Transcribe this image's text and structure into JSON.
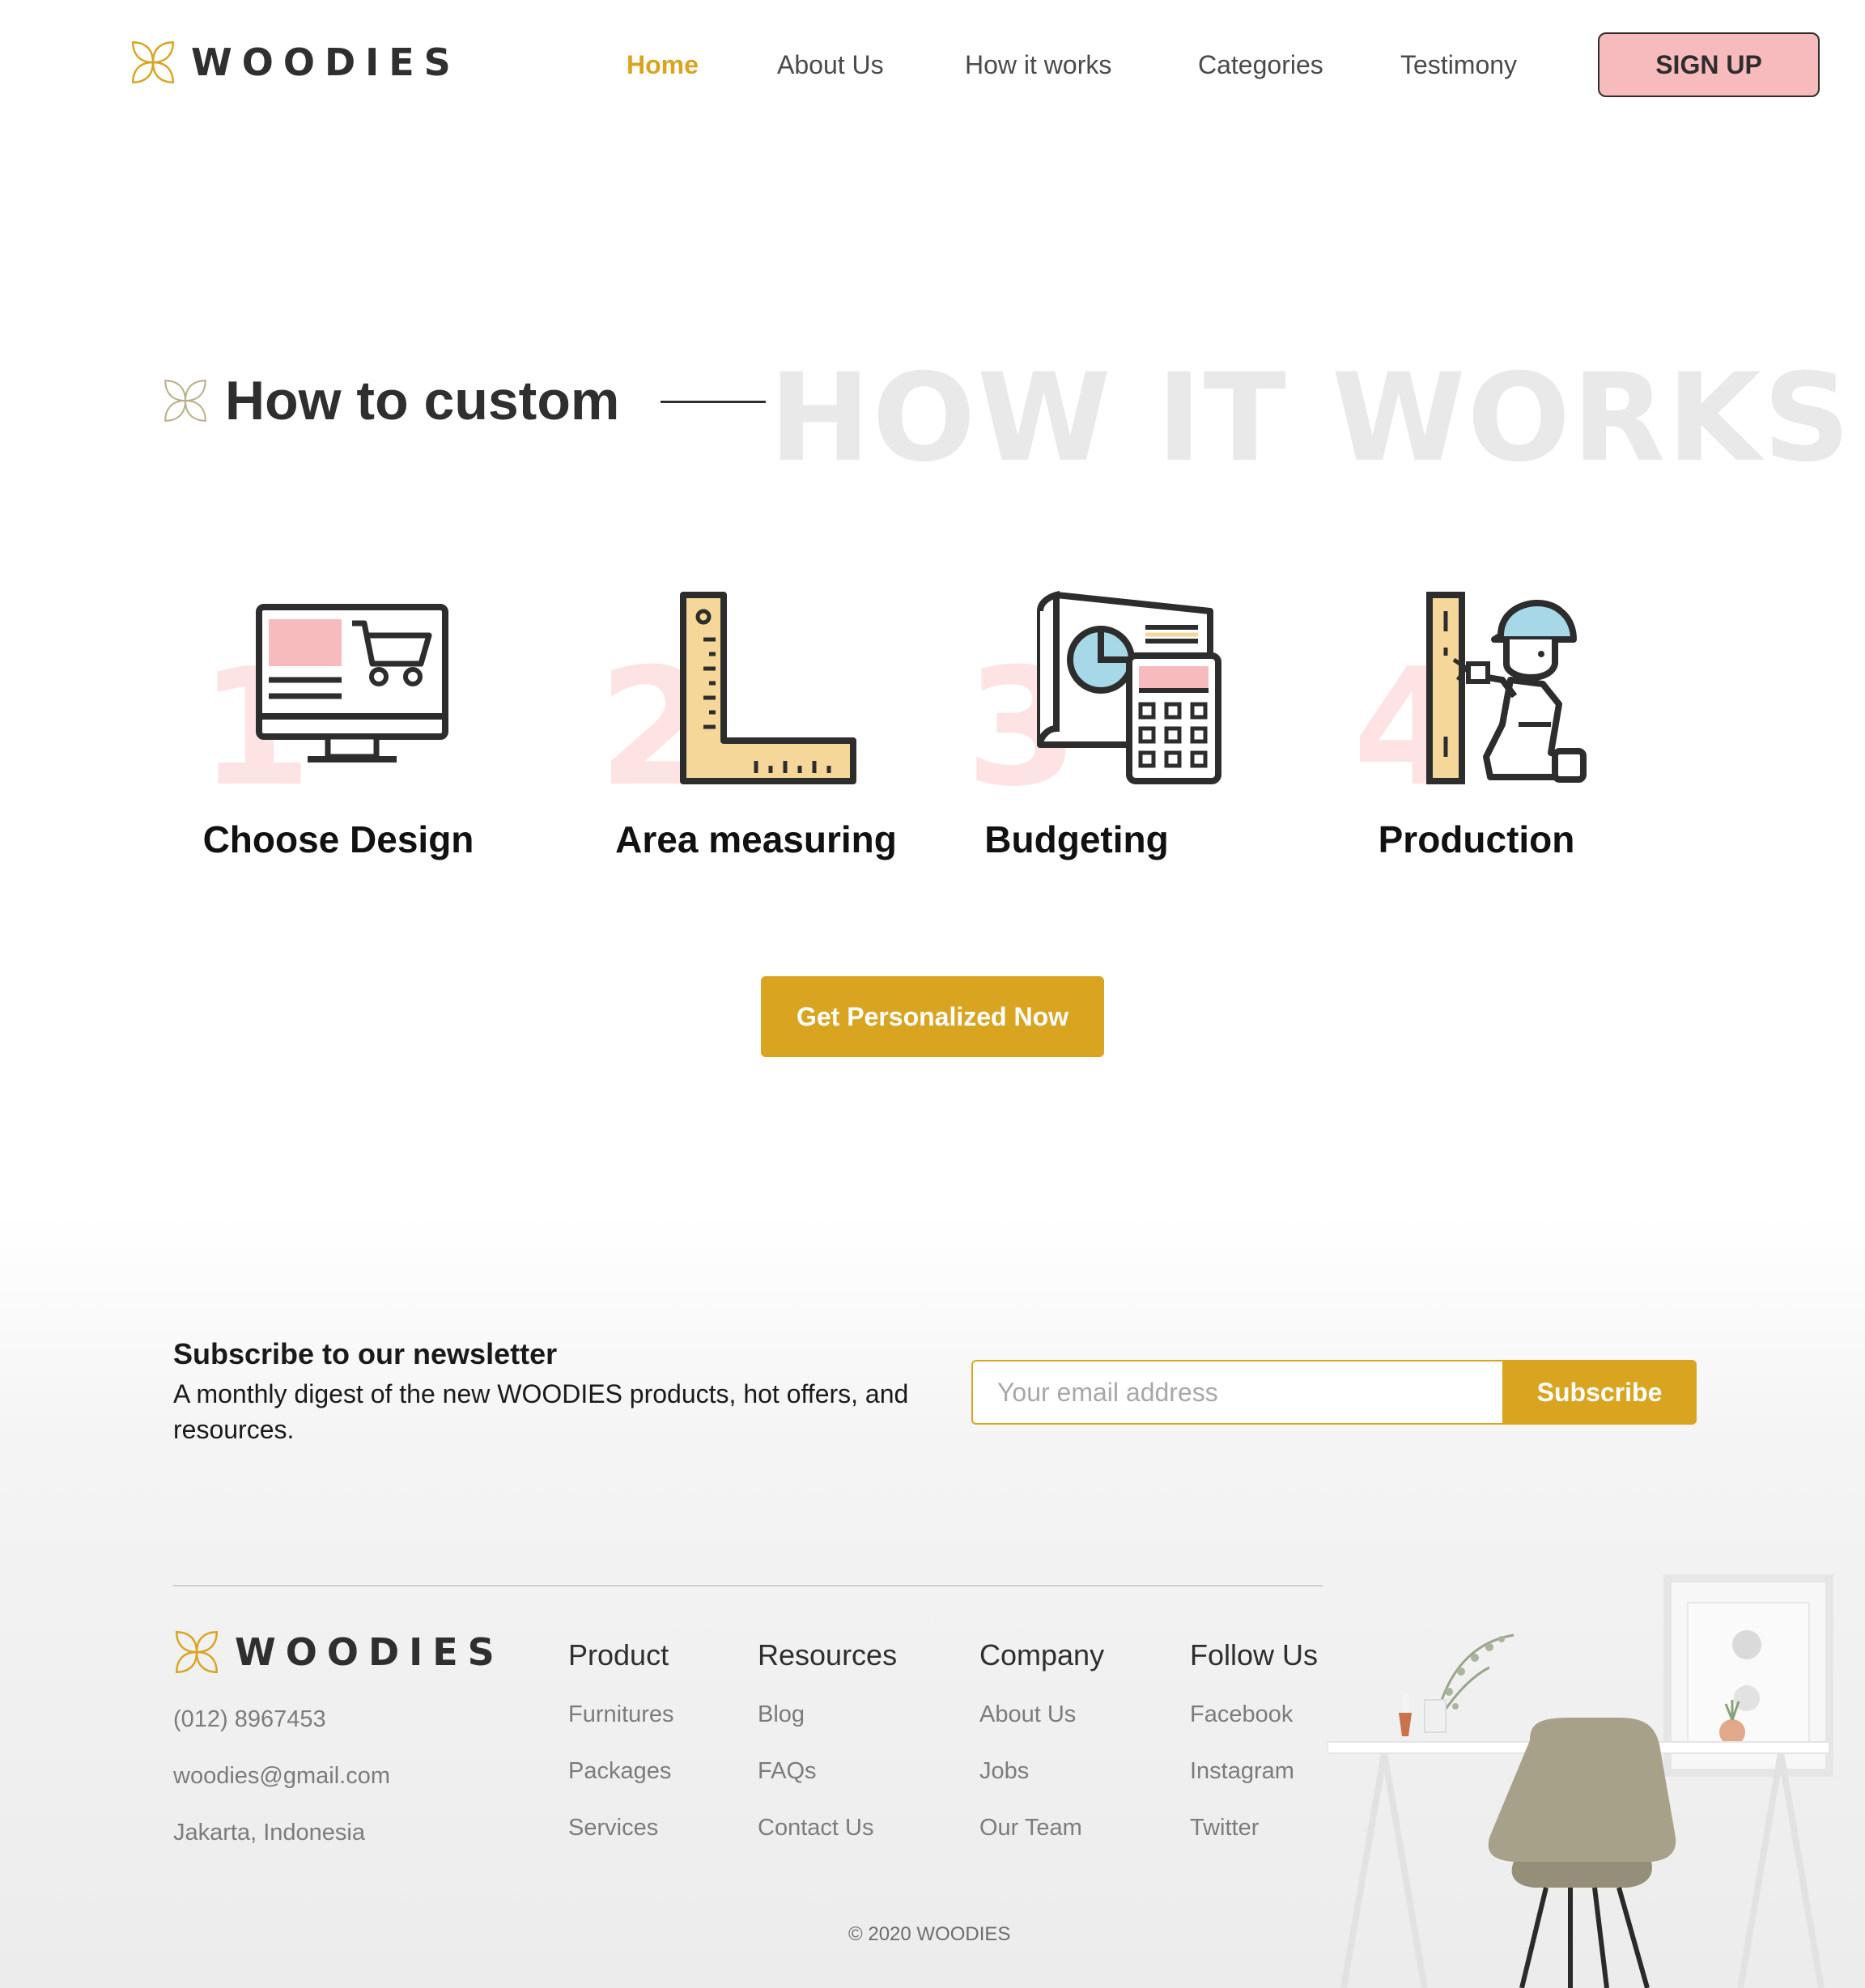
{
  "brand": {
    "name": "WOODIES",
    "accent": "#d9a521",
    "pink": "#f7bbbd"
  },
  "nav": {
    "items": [
      "Home",
      "About Us",
      "How it works",
      "Categories",
      "Testimony"
    ],
    "active": "Home",
    "signup": "SIGN UP"
  },
  "section": {
    "title": "How to custom",
    "watermark": "HOW IT WORKS"
  },
  "steps": [
    {
      "num": "1",
      "label": "Choose Design",
      "icon": "monitor-cart-icon"
    },
    {
      "num": "2",
      "label": "Area measuring",
      "icon": "l-ruler-icon"
    },
    {
      "num": "3",
      "label": "Budgeting",
      "icon": "blueprint-calculator-icon"
    },
    {
      "num": "4",
      "label": "Production",
      "icon": "carpenter-icon"
    }
  ],
  "cta": {
    "label": "Get Personalized Now"
  },
  "newsletter": {
    "title": "Subscribe to our newsletter",
    "description": "A monthly digest of the new WOODIES products, hot offers, and resources.",
    "placeholder": "Your email address",
    "button": "Subscribe"
  },
  "footer": {
    "contact": {
      "phone": "(012) 8967453",
      "email": "woodies@gmail.com",
      "location": "Jakarta, Indonesia"
    },
    "columns": [
      {
        "title": "Product",
        "links": [
          "Furnitures",
          "Packages",
          "Services"
        ]
      },
      {
        "title": "Resources",
        "links": [
          "Blog",
          "FAQs",
          "Contact Us"
        ]
      },
      {
        "title": "Company",
        "links": [
          "About Us",
          "Jobs",
          "Our Team"
        ]
      },
      {
        "title": "Follow Us",
        "links": [
          "Facebook",
          "Instagram",
          "Twitter"
        ]
      }
    ],
    "copyright": "© 2020 WOODIES"
  }
}
